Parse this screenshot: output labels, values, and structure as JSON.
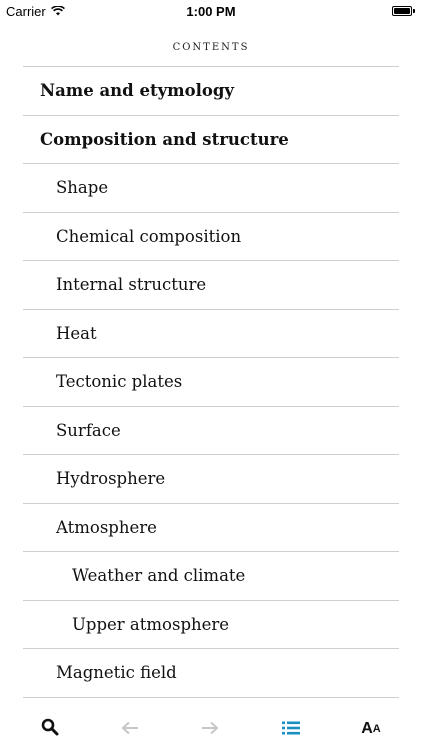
{
  "status_bar": {
    "carrier": "Carrier",
    "time": "1:00 PM"
  },
  "header": {
    "title": "CONTENTS"
  },
  "toc": {
    "items": [
      {
        "label": "Name and etymology",
        "level": 1
      },
      {
        "label": "Composition and structure",
        "level": 1
      },
      {
        "label": "Shape",
        "level": 2
      },
      {
        "label": "Chemical composition",
        "level": 2
      },
      {
        "label": "Internal structure",
        "level": 2
      },
      {
        "label": "Heat",
        "level": 2
      },
      {
        "label": "Tectonic plates",
        "level": 2
      },
      {
        "label": "Surface",
        "level": 2
      },
      {
        "label": "Hydrosphere",
        "level": 2
      },
      {
        "label": "Atmosphere",
        "level": 2
      },
      {
        "label": "Weather and climate",
        "level": 3
      },
      {
        "label": "Upper atmosphere",
        "level": 3
      },
      {
        "label": "Magnetic field",
        "level": 2
      }
    ]
  },
  "toolbar": {
    "search_icon": "search-icon",
    "back_icon": "arrow-left-icon",
    "forward_icon": "arrow-right-icon",
    "contents_icon": "list-icon",
    "text_size_label_big": "A",
    "text_size_label_small": "A"
  },
  "colors": {
    "accent": "#1a8fc2",
    "disabled": "#c7c7c7",
    "divider": "#cfcfcf",
    "text": "#111111"
  }
}
